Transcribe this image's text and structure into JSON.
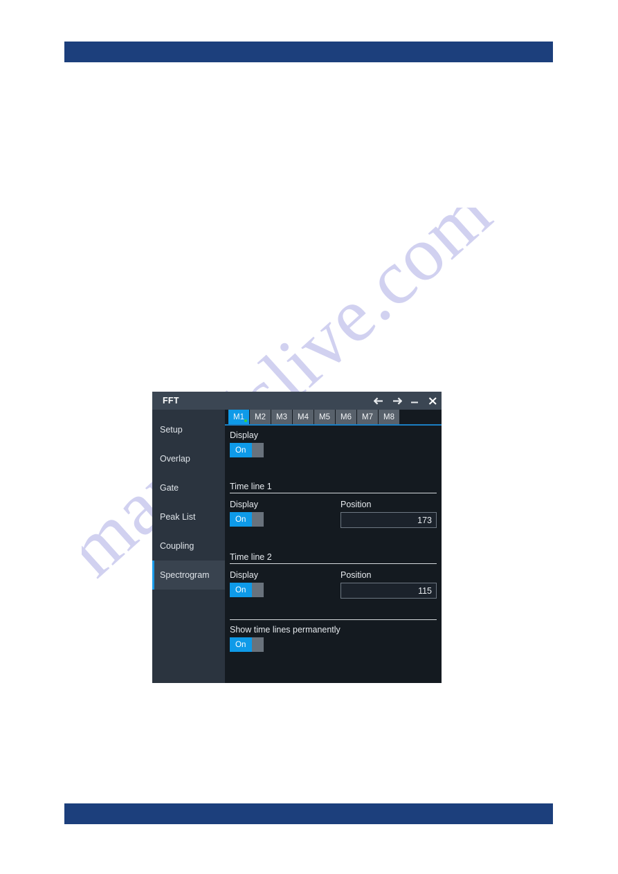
{
  "page": {
    "header_bar_label": "",
    "footer_bar_label": "",
    "watermark_text": "manualslive.com",
    "accent_blue": "#0e9ae8",
    "bar_blue": "#1c3f7c",
    "panel_bg": "#141a20",
    "sidebar_bg": "#2b343f",
    "titlebar_bg": "#3b4653"
  },
  "dialog": {
    "title": "FFT",
    "titlebar_buttons": [
      {
        "name": "back-arrow-icon",
        "glyph": "←"
      },
      {
        "name": "forward-arrow-icon",
        "glyph": "→"
      },
      {
        "name": "minimize-icon",
        "glyph": "–"
      },
      {
        "name": "close-icon",
        "glyph": "✕"
      }
    ],
    "sidebar": {
      "items": [
        {
          "label": "Setup",
          "selected": false
        },
        {
          "label": "Overlap",
          "selected": false
        },
        {
          "label": "Gate",
          "selected": false
        },
        {
          "label": "Peak List",
          "selected": false
        },
        {
          "label": "Coupling",
          "selected": false
        },
        {
          "label": "Spectrogram",
          "selected": true
        }
      ]
    },
    "tabs": [
      {
        "label": "M1",
        "active": true,
        "has_indicator": true
      },
      {
        "label": "M2",
        "active": false,
        "has_indicator": false
      },
      {
        "label": "M3",
        "active": false,
        "has_indicator": false
      },
      {
        "label": "M4",
        "active": false,
        "has_indicator": false
      },
      {
        "label": "M5",
        "active": false,
        "has_indicator": false
      },
      {
        "label": "M6",
        "active": false,
        "has_indicator": false
      },
      {
        "label": "M7",
        "active": false,
        "has_indicator": false
      },
      {
        "label": "M8",
        "active": false,
        "has_indicator": false
      }
    ],
    "spectrogram": {
      "display_label": "Display",
      "display_toggle": "On",
      "time_line_1": {
        "section_title": "Time line 1",
        "display_label": "Display",
        "display_toggle": "On",
        "position_label": "Position",
        "position_value": "173"
      },
      "time_line_2": {
        "section_title": "Time line 2",
        "display_label": "Display",
        "display_toggle": "On",
        "position_label": "Position",
        "position_value": "115"
      },
      "show_permanently_label": "Show time lines permanently",
      "show_permanently_toggle": "On"
    }
  }
}
